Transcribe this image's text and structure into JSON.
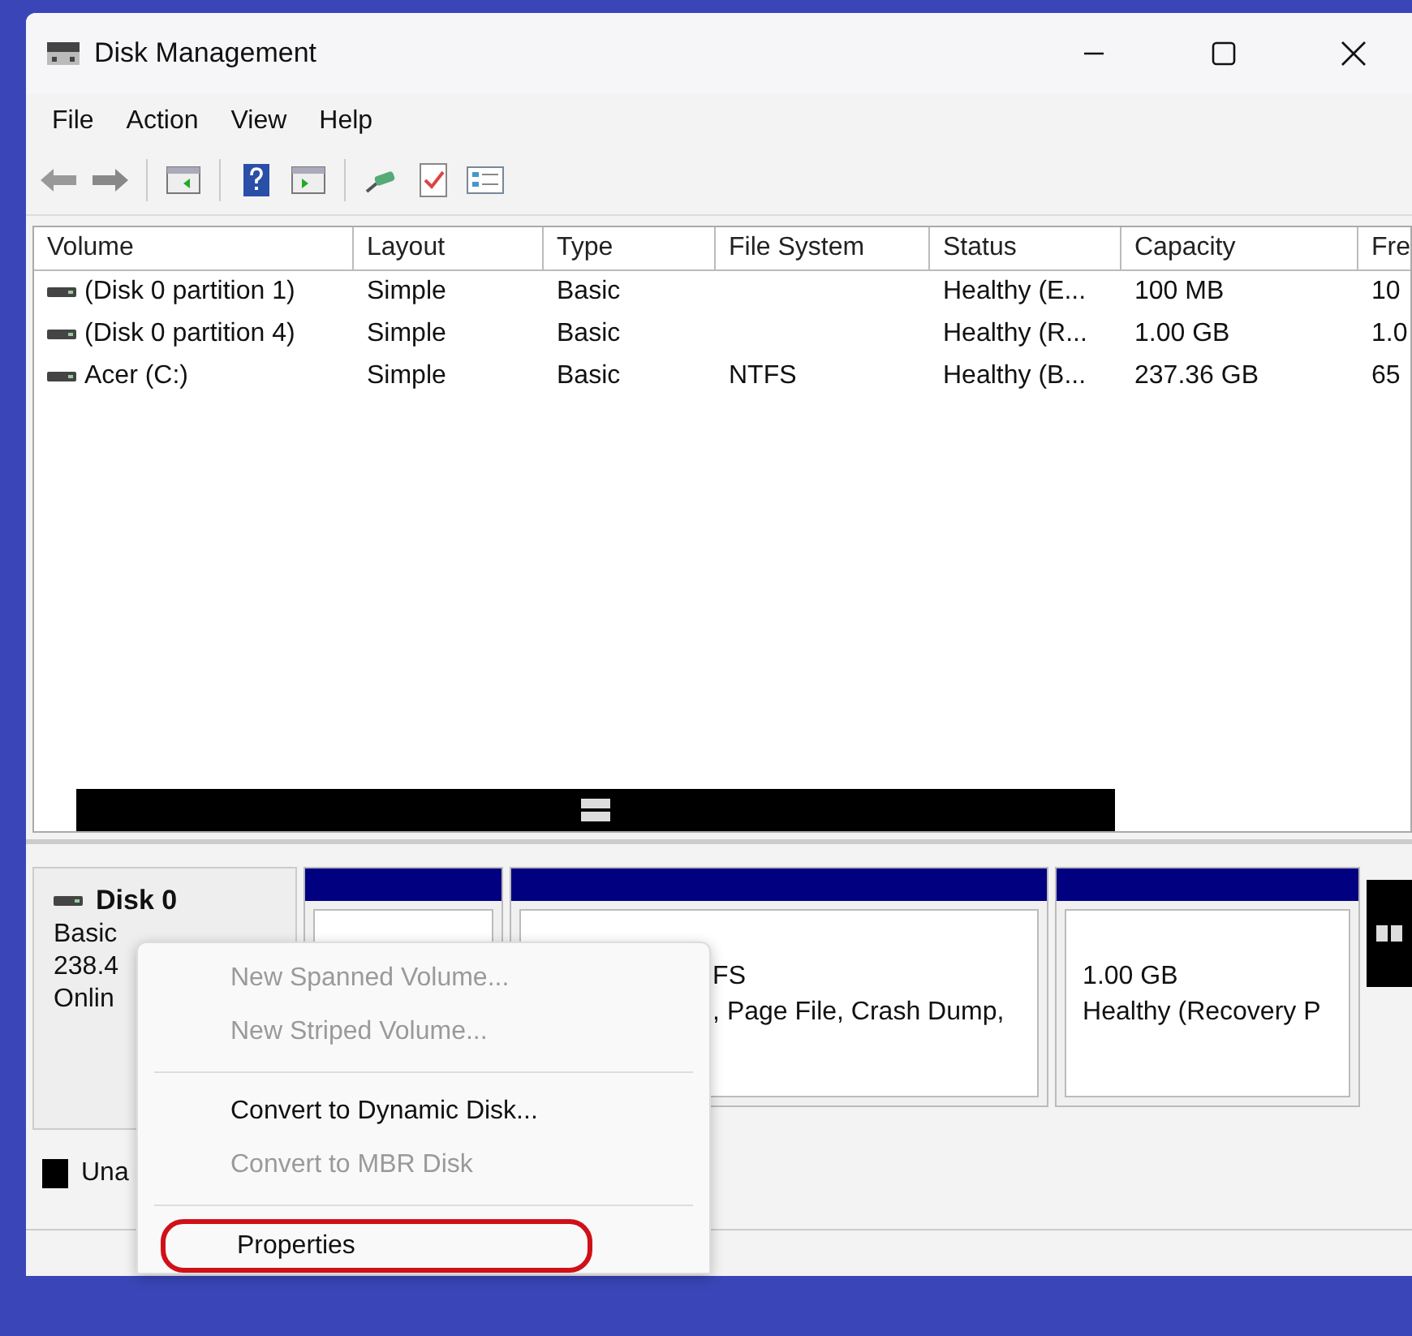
{
  "window": {
    "title": "Disk Management"
  },
  "menu_bar": [
    "File",
    "Action",
    "View",
    "Help"
  ],
  "volume_table": {
    "columns": [
      "Volume",
      "Layout",
      "Type",
      "File System",
      "Status",
      "Capacity",
      "Fre"
    ],
    "rows": [
      [
        "(Disk 0 partition 1)",
        "Simple",
        "Basic",
        "",
        "Healthy (E...",
        "100 MB",
        "10"
      ],
      [
        "(Disk 0 partition 4)",
        "Simple",
        "Basic",
        "",
        "Healthy (R...",
        "1.00 GB",
        "1.0"
      ],
      [
        "Acer (C:)",
        "Simple",
        "Basic",
        "NTFS",
        "Healthy (B...",
        "237.36 GB",
        "65"
      ]
    ]
  },
  "disk": {
    "name": "Disk 0",
    "lines": [
      "Basic",
      "238.4",
      "Onlin"
    ],
    "partitions": [
      {
        "kind": "partition"
      },
      {
        "kind": "partition",
        "lines": [
          "FS",
          ", Page File, Crash Dump,"
        ]
      },
      {
        "kind": "partition",
        "lines": [
          "1.00 GB",
          "Healthy (Recovery P"
        ]
      }
    ]
  },
  "legend": [
    "Una"
  ],
  "context_menu": [
    {
      "kind": "item",
      "label": "New Spanned Volume...",
      "disabled": true,
      "highlighted": false
    },
    {
      "kind": "item",
      "label": "New Striped Volume...",
      "disabled": true,
      "highlighted": false
    },
    {
      "kind": "separator"
    },
    {
      "kind": "item",
      "label": "Convert to Dynamic Disk...",
      "disabled": false,
      "highlighted": false
    },
    {
      "kind": "item",
      "label": "Convert to MBR Disk",
      "disabled": true,
      "highlighted": false
    },
    {
      "kind": "separator"
    },
    {
      "kind": "item",
      "label": "Properties",
      "disabled": false,
      "highlighted": true
    }
  ]
}
